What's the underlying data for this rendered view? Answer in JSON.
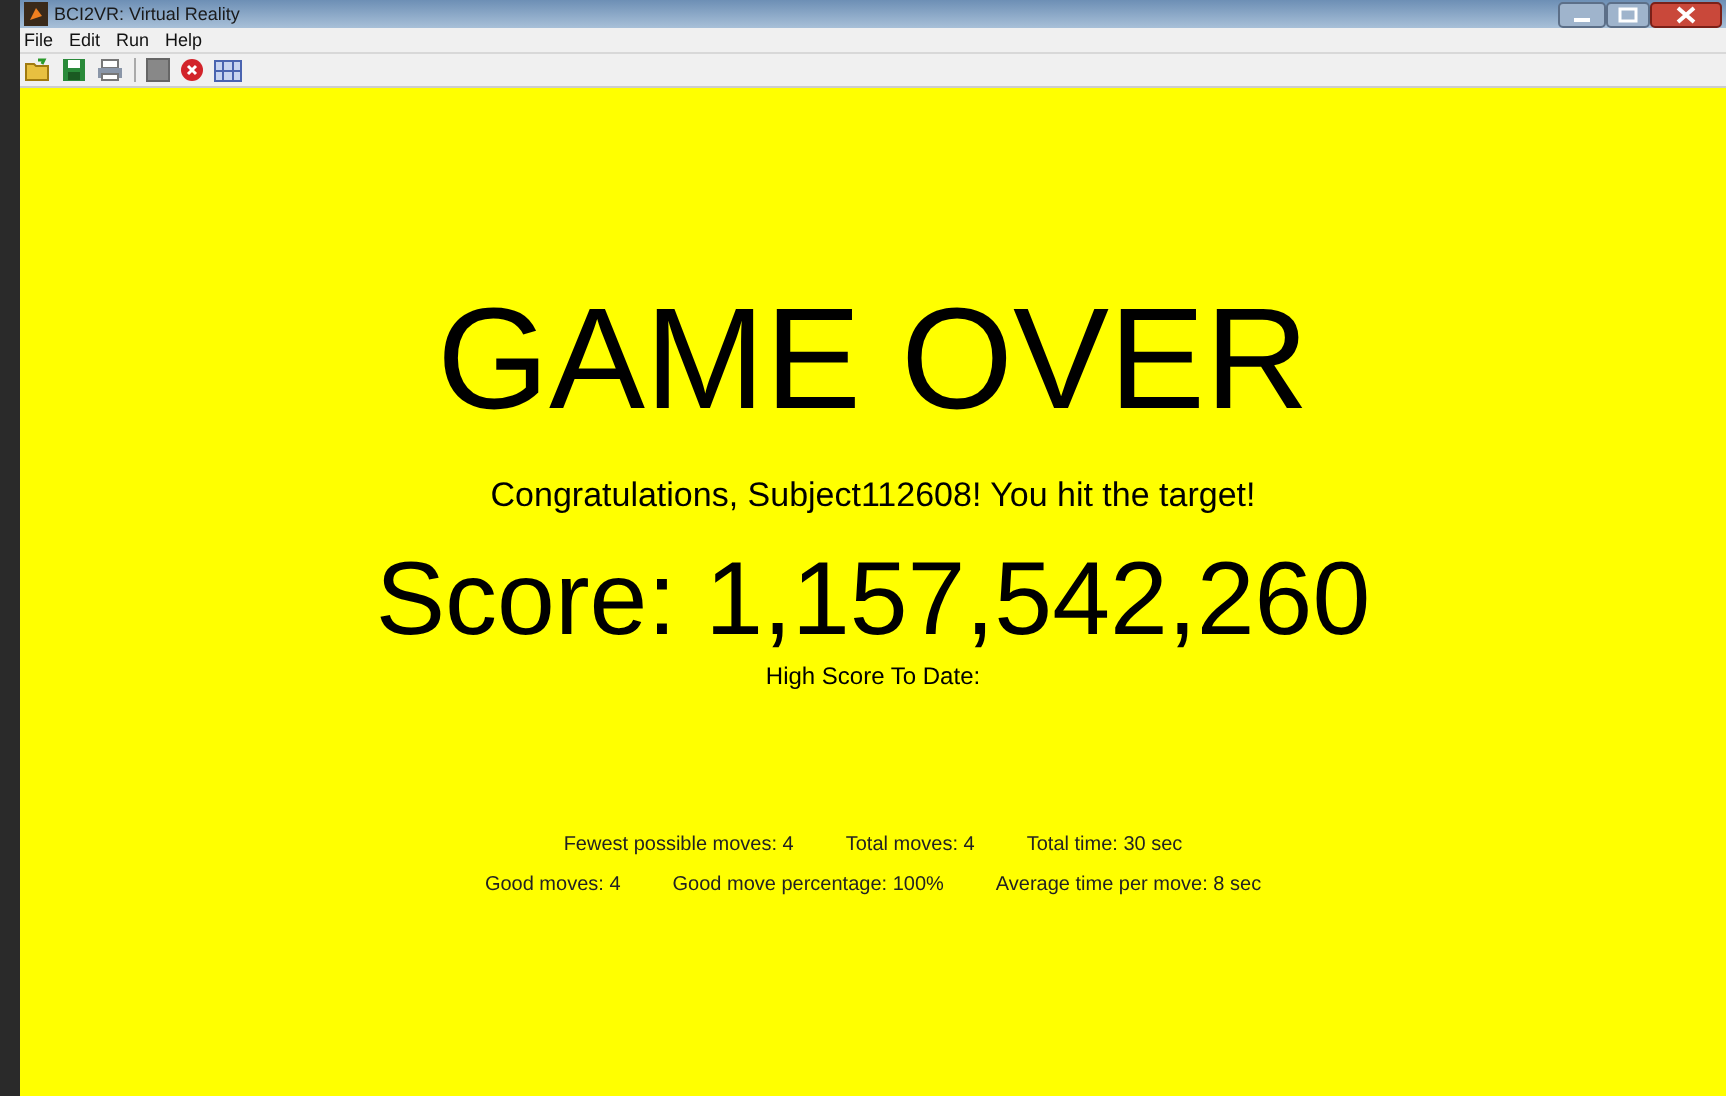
{
  "window": {
    "title": "BCI2VR: Virtual Reality"
  },
  "menu": [
    "File",
    "Edit",
    "Run",
    "Help"
  ],
  "toolbar": [
    {
      "kind": "open"
    },
    {
      "kind": "save"
    },
    {
      "kind": "print"
    },
    {
      "kind": "separator"
    },
    {
      "kind": "stop-square"
    },
    {
      "kind": "stop-circle"
    },
    {
      "kind": "grid"
    }
  ],
  "game": {
    "heading": "GAME OVER",
    "message": "Congratulations, Subject112608!  You hit the target!",
    "score": "Score: 1,157,542,260",
    "high_score": "High Score To Date:",
    "stats": [
      [
        "Fewest possible moves: 4",
        "Total moves: 4",
        "Total time: 30 sec"
      ],
      [
        "Good moves: 4",
        "Good move percentage: 100%",
        "Average time per move: 8 sec"
      ]
    ]
  }
}
